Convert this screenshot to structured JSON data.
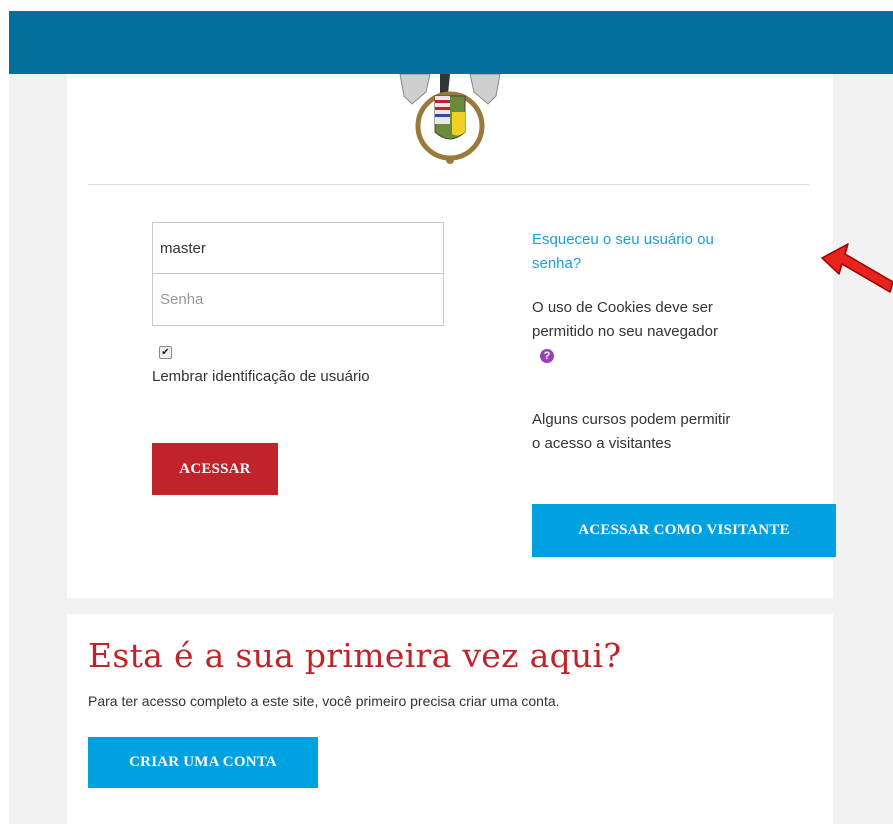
{
  "login": {
    "username_value": "master",
    "password_placeholder": "Senha",
    "remember_checked": true,
    "remember_label": "Lembrar identificação de usuário",
    "submit_label": "ACESSAR"
  },
  "sidebar": {
    "forgot_link": "Esqueceu o seu usuário ou senha?",
    "cookies_text": "O uso de Cookies deve ser permitido no seu navegador",
    "help_icon": "question-circle-icon",
    "guest_text": "Alguns cursos podem permitir o acesso a visitantes",
    "guest_button": "ACESSAR COMO VISITANTE"
  },
  "signup": {
    "title": "Esta é a sua primeira vez aqui?",
    "text": "Para ter acesso completo a este site, você primeiro precisa criar uma conta.",
    "button": "CRIAR UMA CONTA"
  },
  "colors": {
    "topbar": "#036f9c",
    "primary_button": "#c0242a",
    "secondary_button": "#00a1e0",
    "link": "#1a9fd6",
    "annotation_arrow": "#e8231c"
  },
  "icons": {
    "logo": "coat-of-arms-logo",
    "arrow": "red-arrow-annotation"
  }
}
